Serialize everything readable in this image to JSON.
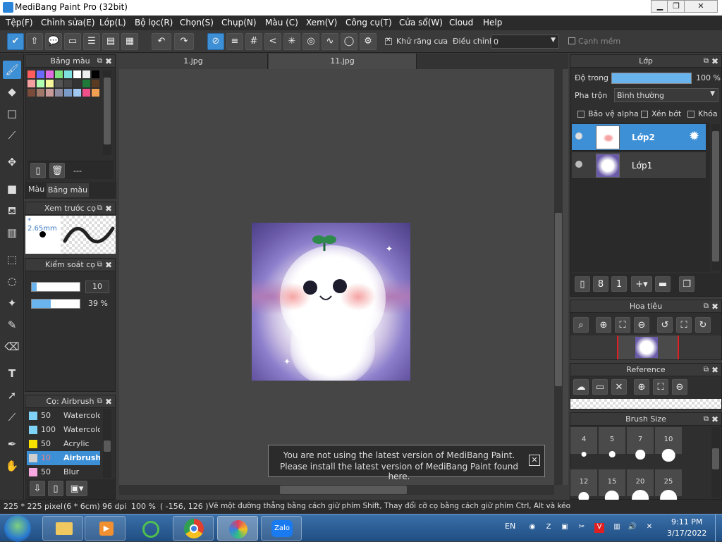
{
  "window": {
    "title": "MediBang Paint Pro (32bit)"
  },
  "menu": [
    "Tệp(F)",
    "Chỉnh sửa(E)",
    "Lớp(L)",
    "Bộ lọc(R)",
    "Chọn(S)",
    "Chụp(N)",
    "Màu (C)",
    "Xem(V)",
    "Công cụ(T)",
    "Cửa sổ(W)",
    "Cloud",
    "Help"
  ],
  "toolbar": {
    "antialias_label": "Khử răng cưa",
    "adjust_label": "Điều chỉnh",
    "adjust_value": "0",
    "soft_edge_label": "Cạnh mềm"
  },
  "panels": {
    "palette": {
      "title": "Bảng màu",
      "count_text": "---",
      "tab_color": "Màu",
      "tab_palette": "Bảng màu"
    },
    "brush_preview": {
      "title": "Xem trước cọ",
      "size_text": "* 2.65mm"
    },
    "brush_control": {
      "title": "Kiểm soát cọ",
      "size_value": "10",
      "opacity_value": "39 %",
      "size_fraction": 0.1,
      "opacity_fraction": 0.39
    },
    "brush": {
      "title": "Cọ: Airbrush",
      "items": [
        {
          "size": "50",
          "name": "Watercolor",
          "color": "#7fd3f7"
        },
        {
          "size": "100",
          "name": "Watercolor",
          "color": "#7fd3f7"
        },
        {
          "size": "50",
          "name": "Acrylic",
          "color": "#f5e000"
        },
        {
          "size": "10",
          "name": "Airbrush",
          "color": "#cfcfcf"
        },
        {
          "size": "50",
          "name": "Blur",
          "color": "#f7a8e0"
        }
      ]
    },
    "layer": {
      "title": "Lớp",
      "opacity_label": "Độ trong",
      "opacity_value": "100 %",
      "blend_label": "Pha trộn",
      "blend_value": "Bình thường",
      "protect_alpha": "Bảo vệ alpha",
      "clipping": "Xén bớt",
      "lock": "Khóa",
      "layers": [
        "Lớp2",
        "Lớp1"
      ]
    },
    "navigator": {
      "title": "Hoa tiêu"
    },
    "reference": {
      "title": "Reference"
    },
    "brush_size": {
      "title": "Brush Size",
      "sizes": [
        "4",
        "5",
        "7",
        "10",
        "12",
        "15",
        "20",
        "25"
      ]
    }
  },
  "tabs": [
    "1.jpg",
    "11.jpg"
  ],
  "notice": {
    "line1": "You are not using the latest version of MediBang Paint.",
    "line2": "Please install the latest version of MediBang Paint found here."
  },
  "status": {
    "size": "225 * 225 pixel",
    "cm": "(6 * 6cm)",
    "dpi": "96 dpi",
    "zoom": "100 %",
    "coords": "( -156, 126 )",
    "hint": "Vẽ một đường thẳng bằng cách giữ phím Shift, Thay đổi cỡ cọ bằng cách giữ phím Ctrl, Alt và kéo"
  },
  "taskbar": {
    "lang": "EN",
    "time": "9:11 PM",
    "date": "3/17/2022",
    "zalo": "Zalo"
  }
}
